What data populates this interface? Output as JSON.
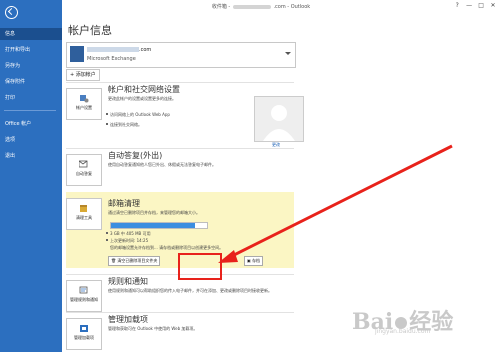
{
  "titlebar": {
    "title_prefix": "收件箱 -",
    "title_suffix": ".com - Outlook",
    "controls": [
      "?",
      "—",
      "□",
      "✕"
    ]
  },
  "sidebar": {
    "items": [
      {
        "label": "信息"
      },
      {
        "label": "打开和导出"
      },
      {
        "label": "另存为"
      },
      {
        "label": "保存附件"
      },
      {
        "label": "打印"
      },
      {
        "label": "Office 帐户"
      },
      {
        "label": "选项"
      },
      {
        "label": "退出"
      }
    ]
  },
  "page_title": "帐户信息",
  "account": {
    "email_suffix": ".com",
    "type": "Microsoft Exchange"
  },
  "add_account_label": "添加帐户",
  "account_settings": {
    "button_label": "帐户设置",
    "title": "帐户和社交网络设置",
    "desc": "更改此帐户的设置或设置更多的连接。",
    "bullets": [
      "访问网络上的 Outlook Web App",
      "连接到社交网络。"
    ]
  },
  "profile_picture": {
    "change_label": "更改"
  },
  "auto_reply": {
    "button_label": "自动答复",
    "title": "自动答复(外出)",
    "desc": "使用自动答复通知他人您已外出、休假或无法答复电子邮件。"
  },
  "mailbox_cleanup": {
    "button_label": "清理工具",
    "title": "邮箱清理",
    "desc": "通过清空已删除项目并存档，来管理您的邮箱大小。",
    "quota_text": "3 GB 中 405 MB 可用",
    "quota_fraction": 0.87,
    "last_sync": "上次更新时间: 14:25",
    "archive_info": "您的邮箱设置允许存档到... 请存档或删除项目以创建更多空间。",
    "empty_deleted_button": "清空已删除项目文件夹",
    "archive_button": "存档"
  },
  "rules_alerts": {
    "button_label": "管理规则和通知",
    "title": "规则和通知",
    "desc": "使用规则和通知可以帮助组织您的传入电子邮件，并可在添加、更改或删除项目时接收更新。"
  },
  "manage_addins": {
    "button_label": "管理加载项",
    "title": "管理加载项",
    "desc": "管理和获取可在 Outlook 中使用的 Web 加载项。"
  },
  "watermark": {
    "brand_left": "Bai",
    "brand_right": "经验",
    "url": "jingyan.baidu.com"
  },
  "colors": {
    "sidebar": "#2c6fbf",
    "sidebar_active": "#1b4f8f",
    "highlight_bg": "#fbf6c4",
    "annotation": "#e8221b"
  }
}
